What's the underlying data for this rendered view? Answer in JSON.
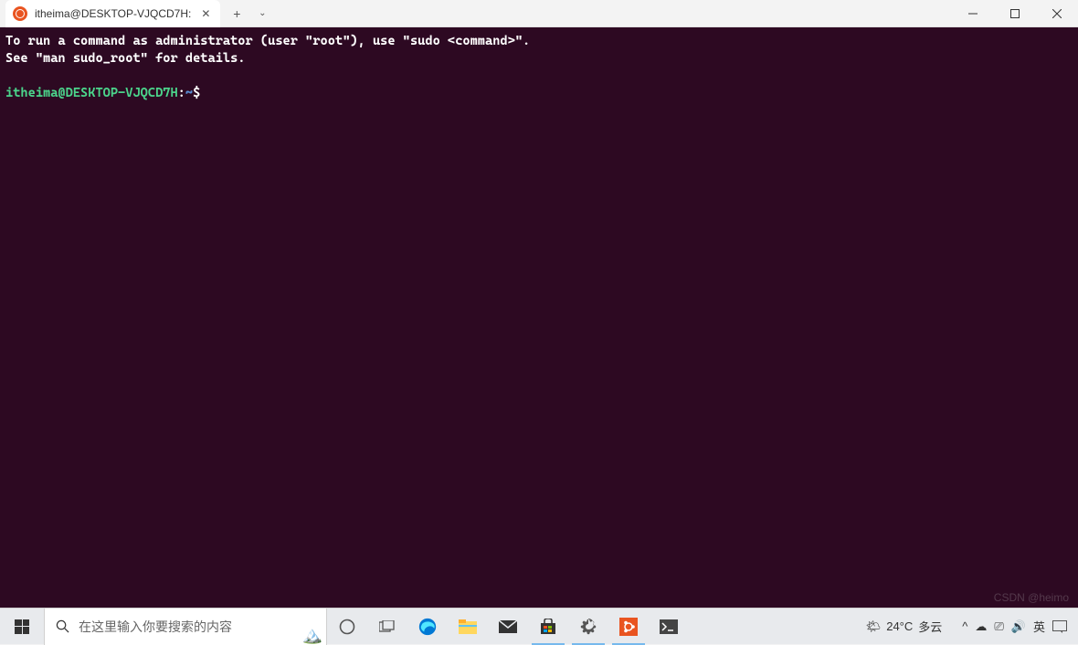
{
  "titlebar": {
    "tab_title": "itheima@DESKTOP-VJQCD7H:",
    "close_glyph": "✕",
    "new_tab_glyph": "+",
    "dropdown_glyph": "⌄"
  },
  "window_controls": {
    "minimize": "—",
    "maximize": "▢",
    "close": "✕"
  },
  "terminal": {
    "line1": "To run a command as administrator (user \"root\"), use \"sudo <command>\".",
    "line2": "See \"man sudo_root\" for details.",
    "prompt_user": "itheima@DESKTOP-VJQCD7H",
    "prompt_sep1": ":",
    "prompt_path": "~",
    "prompt_sep2": "$"
  },
  "taskbar": {
    "search_placeholder": "在这里输入你要搜索的内容"
  },
  "tray": {
    "weather_icon": "🌤",
    "temperature": "24°C",
    "condition": "多云",
    "chevron": "^",
    "cloud": "☁",
    "monitor": "⎚",
    "speaker": "🔊",
    "ime": "英",
    "notifications": "▭"
  },
  "watermark": "CSDN @heimo"
}
